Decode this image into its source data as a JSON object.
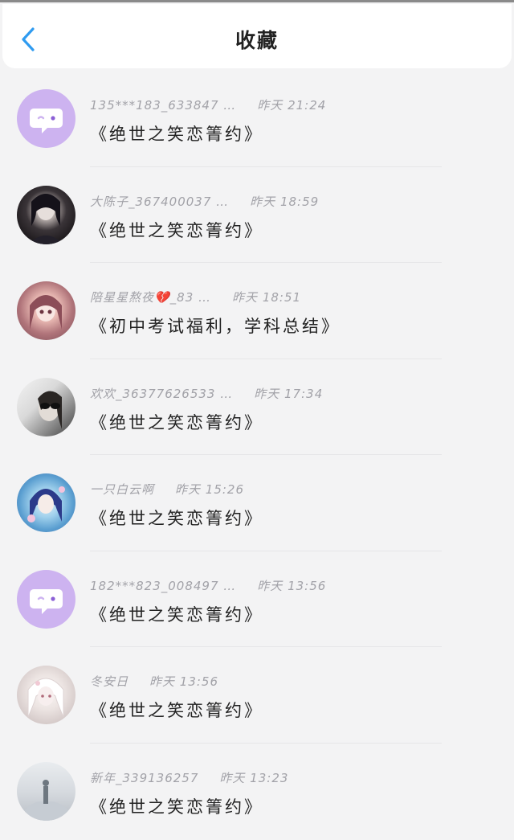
{
  "header": {
    "title": "收藏",
    "back_icon": "chevron-left-icon"
  },
  "colors": {
    "accent": "#2f9bf0",
    "bot_avatar": "#cdb3f0"
  },
  "items": [
    {
      "user": "135***183_633847 …",
      "time": "昨天 21:24",
      "message": "《绝世之笑恋箐约》",
      "avatar": "chat-bubble-icon"
    },
    {
      "user": "大陈子_367400037 …",
      "time": "昨天 18:59",
      "message": "《绝世之笑恋箐约》",
      "avatar": "user-photo"
    },
    {
      "user": "陪星星熬夜💔_83 …",
      "time": "昨天 18:51",
      "message": "《初中考试福利，学科总结》",
      "avatar": "user-photo"
    },
    {
      "user": "欢欢_36377626533 …",
      "time": "昨天 17:34",
      "message": "《绝世之笑恋箐约》",
      "avatar": "user-photo"
    },
    {
      "user": "一只白云啊",
      "time": "昨天 15:26",
      "message": "《绝世之笑恋箐约》",
      "avatar": "user-photo"
    },
    {
      "user": "182***823_008497 …",
      "time": "昨天 13:56",
      "message": "《绝世之笑恋箐约》",
      "avatar": "chat-bubble-icon"
    },
    {
      "user": "冬安日",
      "time": "昨天 13:56",
      "message": "《绝世之笑恋箐约》",
      "avatar": "user-photo"
    },
    {
      "user": "新年_339136257",
      "time": "昨天 13:23",
      "message": "《绝世之笑恋箐约》",
      "avatar": "user-photo"
    }
  ]
}
